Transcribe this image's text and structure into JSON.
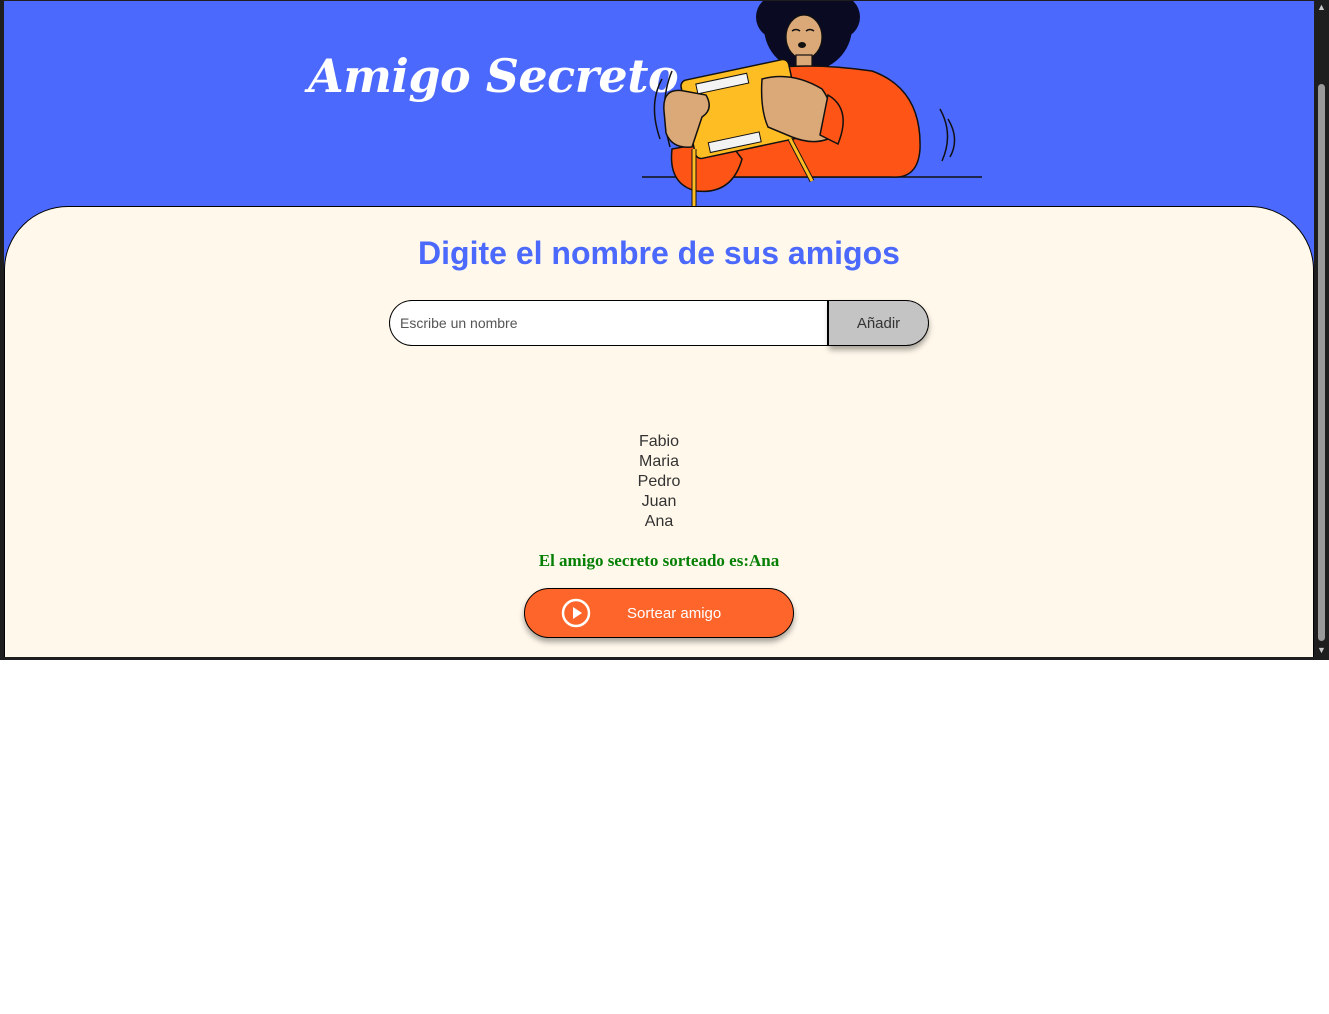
{
  "header": {
    "title": "Amigo Secreto"
  },
  "main": {
    "section_title": "Digite el nombre de sus amigos",
    "input": {
      "placeholder": "Escribe un nombre",
      "value": ""
    },
    "add_button_label": "Añadir",
    "friends": [
      "Fabio",
      "Maria",
      "Pedro",
      "Juan",
      "Ana"
    ],
    "result_text": "El amigo secreto sorteado es:Ana",
    "draw_button_label": "Sortear amigo"
  },
  "icons": {
    "draw_button_icon": "play-circle-icon",
    "header_illustration": "person-opening-gift-illustration"
  },
  "colors": {
    "header_background": "#4b69fd",
    "panel_background": "#fff8eb",
    "accent_blue": "#4b69fd",
    "draw_button": "#fe652b",
    "add_button": "#c4c4c4",
    "result_text": "#058005"
  }
}
